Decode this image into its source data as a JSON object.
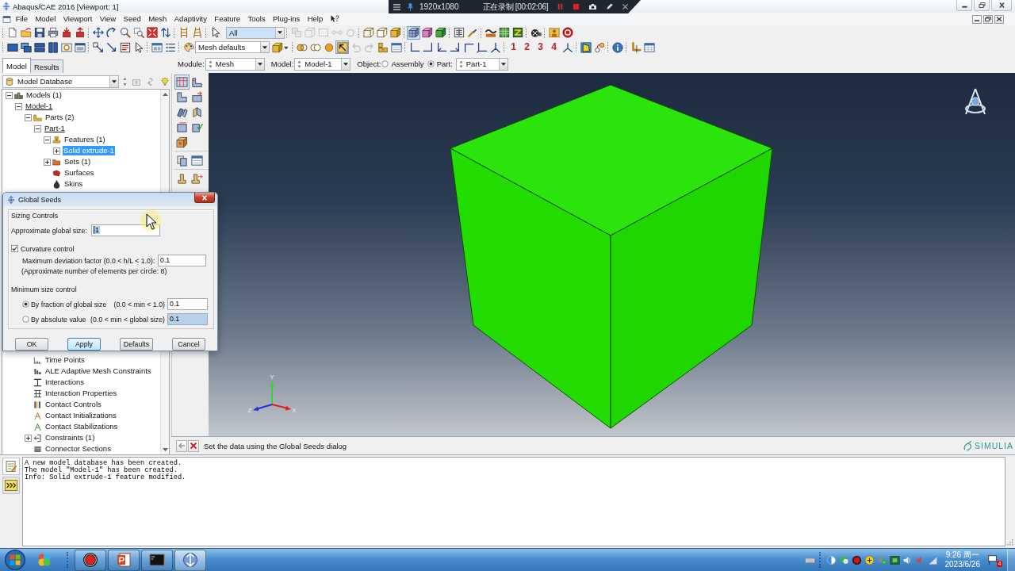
{
  "window": {
    "title": "Abaqus/CAE 2016 [Viewport: 1]"
  },
  "recorder": {
    "resolution": "1920x1080",
    "status": "正在录制 [00:02:06]"
  },
  "menu": [
    "File",
    "Model",
    "Viewport",
    "View",
    "Seed",
    "Mesh",
    "Adaptivity",
    "Feature",
    "Tools",
    "Plug-ins",
    "Help"
  ],
  "toolbars": [
    [
      [
        {
          "kind": "button",
          "pressed": false,
          "disabled": false
        },
        {
          "kind": "button",
          "pressed": false,
          "disabled": false
        },
        {
          "kind": "button",
          "pressed": false,
          "disabled": false
        },
        {
          "kind": "button",
          "pressed": false,
          "disabled": false
        },
        {
          "kind": "button",
          "pressed": false,
          "disabled": false
        },
        {
          "kind": "button",
          "pressed": false,
          "disabled": false
        }
      ],
      [
        {
          "kind": "button",
          "pressed": false,
          "disabled": false
        },
        {
          "kind": "button",
          "pressed": false,
          "disabled": false
        },
        {
          "kind": "button",
          "pressed": false,
          "disabled": false
        },
        {
          "kind": "button",
          "pressed": false,
          "disabled": false
        },
        {
          "kind": "button",
          "pressed": false,
          "disabled": false
        },
        {
          "kind": "button",
          "pressed": false,
          "disabled": false
        }
      ],
      [
        {
          "kind": "button",
          "pressed": false,
          "disabled": false
        },
        {
          "kind": "button",
          "pressed": false,
          "disabled": false
        }
      ],
      [
        {
          "kind": "button",
          "pressed": false,
          "disabled": false
        },
        {
          "kind": "combo",
          "value": "All"
        }
      ],
      [
        {
          "kind": "button",
          "pressed": false,
          "disabled": true
        },
        {
          "kind": "button",
          "pressed": false,
          "disabled": true
        },
        {
          "kind": "button",
          "pressed": false,
          "disabled": true
        },
        {
          "kind": "button",
          "pressed": false,
          "disabled": true
        },
        {
          "kind": "button",
          "pressed": false,
          "disabled": true
        }
      ],
      [
        {
          "kind": "button",
          "pressed": false,
          "disabled": false
        },
        {
          "kind": "button",
          "pressed": false,
          "disabled": false
        },
        {
          "kind": "button",
          "pressed": false,
          "disabled": false
        }
      ],
      [
        {
          "kind": "button",
          "pressed": true,
          "disabled": false
        },
        {
          "kind": "button",
          "pressed": false,
          "disabled": false
        },
        {
          "kind": "button",
          "pressed": false,
          "disabled": false
        }
      ],
      [
        {
          "kind": "button",
          "pressed": false,
          "disabled": false
        },
        {
          "kind": "button",
          "pressed": false,
          "disabled": false
        }
      ],
      [
        {
          "kind": "button",
          "pressed": false,
          "disabled": false
        },
        {
          "kind": "button",
          "pressed": false,
          "disabled": false
        },
        {
          "kind": "button",
          "pressed": false,
          "disabled": false
        }
      ],
      [
        {
          "kind": "button",
          "pressed": false,
          "disabled": false
        }
      ],
      [
        {
          "kind": "button",
          "pressed": false,
          "disabled": false
        },
        {
          "kind": "button",
          "pressed": false,
          "disabled": false
        }
      ]
    ],
    [
      [
        {
          "kind": "button",
          "pressed": false,
          "disabled": false
        },
        {
          "kind": "button",
          "pressed": false,
          "disabled": false
        },
        {
          "kind": "button",
          "pressed": false,
          "disabled": false
        },
        {
          "kind": "button",
          "pressed": false,
          "disabled": false
        },
        {
          "kind": "button",
          "pressed": false,
          "disabled": false
        },
        {
          "kind": "button",
          "pressed": false,
          "disabled": false
        }
      ],
      [
        {
          "kind": "button",
          "pressed": false,
          "disabled": false
        },
        {
          "kind": "button",
          "pressed": false,
          "disabled": false
        },
        {
          "kind": "button",
          "pressed": false,
          "disabled": false
        },
        {
          "kind": "button",
          "pressed": false,
          "disabled": false
        }
      ],
      [
        {
          "kind": "button",
          "pressed": false,
          "disabled": false
        },
        {
          "kind": "button",
          "pressed": false,
          "disabled": false
        }
      ],
      [
        {
          "kind": "button",
          "pressed": false,
          "disabled": false
        },
        {
          "kind": "combo",
          "value": "Mesh defaults"
        },
        {
          "kind": "button",
          "pressed": false,
          "disabled": false
        }
      ],
      [
        {
          "kind": "button",
          "pressed": false,
          "disabled": false
        },
        {
          "kind": "button",
          "pressed": false,
          "disabled": false
        },
        {
          "kind": "button",
          "pressed": false,
          "disabled": false
        },
        {
          "kind": "button",
          "pressed": true,
          "disabled": false
        },
        {
          "kind": "button",
          "pressed": false,
          "disabled": true
        },
        {
          "kind": "button",
          "pressed": false,
          "disabled": true
        },
        {
          "kind": "button",
          "pressed": false,
          "disabled": false
        },
        {
          "kind": "button",
          "pressed": false,
          "disabled": false
        }
      ],
      [
        {
          "kind": "button",
          "pressed": false,
          "disabled": false
        },
        {
          "kind": "button",
          "pressed": false,
          "disabled": false
        },
        {
          "kind": "button",
          "pressed": false,
          "disabled": false
        },
        {
          "kind": "button",
          "pressed": false,
          "disabled": false
        },
        {
          "kind": "button",
          "pressed": false,
          "disabled": false
        },
        {
          "kind": "button",
          "pressed": false,
          "disabled": false
        },
        {
          "kind": "button",
          "pressed": false,
          "disabled": false
        }
      ],
      [
        {
          "kind": "digit",
          "label": "1"
        },
        {
          "kind": "digit",
          "label": "2"
        },
        {
          "kind": "digit",
          "label": "3"
        },
        {
          "kind": "digit",
          "label": "4"
        },
        {
          "kind": "button",
          "pressed": false,
          "disabled": false
        }
      ],
      [
        {
          "kind": "button",
          "pressed": false,
          "disabled": false
        },
        {
          "kind": "button",
          "pressed": false,
          "disabled": false
        }
      ],
      [
        {
          "kind": "button",
          "pressed": false,
          "disabled": false
        }
      ],
      [
        {
          "kind": "button",
          "pressed": false,
          "disabled": false
        },
        {
          "kind": "button",
          "pressed": false,
          "disabled": false
        }
      ]
    ]
  ],
  "context": {
    "module": {
      "label": "Module:",
      "value": "Mesh"
    },
    "model": {
      "label": "Model:",
      "value": "Model-1"
    },
    "object": {
      "label": "Object:",
      "options": [
        {
          "label": "Assembly",
          "selected": false
        },
        {
          "label": "Part:",
          "selected": true
        }
      ]
    },
    "part": {
      "value": "Part-1"
    }
  },
  "model_tree": {
    "tabs": [
      {
        "label": "Model",
        "selected": true
      },
      {
        "label": "Results",
        "selected": false
      }
    ],
    "source": "Model Database",
    "items": [
      {
        "label": "Models (1)",
        "kind": "models",
        "expanded": true,
        "selected": false,
        "current": false,
        "children": [
          {
            "label": "Model-1",
            "expanded": true,
            "selected": false,
            "current": true,
            "children": [
              {
                "label": "Parts (2)",
                "kind": "parts",
                "expanded": true,
                "selected": false,
                "current": false,
                "children": [
                  {
                    "label": "Part-1",
                    "expanded": true,
                    "selected": false,
                    "current": true,
                    "children": [
                      {
                        "label": "Features (1)",
                        "kind": "features",
                        "expanded": true,
                        "selected": false,
                        "current": false,
                        "children": [
                          {
                            "label": "Solid extrude-1",
                            "expanded": false,
                            "selected": true,
                            "current": false
                          }
                        ]
                      },
                      {
                        "label": "Sets (1)",
                        "kind": "sets",
                        "expanded": false,
                        "selected": false,
                        "current": false
                      },
                      {
                        "label": "Surfaces",
                        "kind": "surfaces",
                        "selected": false,
                        "current": false
                      },
                      {
                        "label": "Skins",
                        "kind": "skins",
                        "selected": false,
                        "current": false
                      }
                    ]
                  }
                ]
              },
              {
                "label": "Time Points",
                "kind": "timepoints",
                "selected": false,
                "current": false
              },
              {
                "label": "ALE Adaptive Mesh Constraints",
                "kind": "adaptive",
                "selected": false,
                "current": false
              },
              {
                "label": "Interactions",
                "kind": "interactions",
                "selected": false,
                "current": false
              },
              {
                "label": "Interaction Properties",
                "kind": "properties",
                "selected": false,
                "current": false
              },
              {
                "label": "Contact Controls",
                "kind": "controls",
                "selected": false,
                "current": false
              },
              {
                "label": "Contact Initializations",
                "kind": "initializations",
                "selected": false,
                "current": false
              },
              {
                "label": "Contact Stabilizations",
                "kind": "stabilizations",
                "selected": false,
                "current": false
              },
              {
                "label": "Constraints (1)",
                "kind": "constraints",
                "expanded": false,
                "selected": false,
                "current": false
              },
              {
                "label": "Connector Sections",
                "kind": "connectors",
                "selected": false,
                "current": false
              }
            ]
          }
        ]
      }
    ]
  },
  "toolbox": [
    [
      {
        "pressed": true
      },
      {
        "pressed": false
      },
      {
        "pressed": false
      },
      {
        "pressed": false
      },
      {
        "pressed": false
      },
      {
        "pressed": false
      },
      {
        "pressed": false
      },
      {
        "pressed": false
      },
      {
        "pressed": false
      }
    ],
    [
      {
        "pressed": false
      },
      {
        "pressed": false
      }
    ],
    [
      {
        "pressed": false
      },
      {
        "pressed": false
      }
    ]
  ],
  "viewport": {
    "axes": {
      "x": "X",
      "y": "Y",
      "z": "Z"
    }
  },
  "dialog": {
    "title": "Global Seeds",
    "group": "Sizing Controls",
    "size": {
      "label": "Approximate global size:",
      "value": "1",
      "text_selected": true
    },
    "curvature": {
      "label": "Curvature control",
      "checked": true
    },
    "deviation": {
      "label": "Maximum deviation factor (0.0 < h/L < 1.0):",
      "value": "0.1"
    },
    "note": "(Approximate number of elements per circle: 8)",
    "min_size": {
      "label": "Minimum size control",
      "options": [
        {
          "label": "By fraction of global size",
          "range": "(0.0 < min < 1.0)",
          "value": "0.1",
          "selected": true,
          "disabled": false
        },
        {
          "label": "By absolute value",
          "range": "(0.0 < min < global size)",
          "value": "0.1",
          "selected": false,
          "disabled": true
        }
      ]
    },
    "buttons": [
      {
        "label": "OK",
        "focused": false
      },
      {
        "label": "Apply",
        "focused": true
      },
      {
        "label": "Defaults",
        "focused": false
      },
      {
        "label": "Cancel",
        "focused": false
      }
    ]
  },
  "prompt": {
    "text": "Set the data using the Global Seeds dialog",
    "brand": "SIMULIA"
  },
  "messages": {
    "tabs": [
      {
        "selected": true
      },
      {
        "selected": false
      }
    ],
    "lines": [
      "A new model database has been created.",
      "The model \"Model-1\" has been created.",
      "Info: Solid extrude-1 feature modified."
    ]
  },
  "taskbar": {
    "apps": [
      {
        "running": false,
        "selected": false
      },
      {
        "running": true,
        "selected": false
      },
      {
        "running": true,
        "selected": false
      },
      {
        "running": true,
        "selected": false
      },
      {
        "running": true,
        "selected": true
      }
    ],
    "clock": {
      "time": "9:26 周一",
      "date": "2023/6/26"
    },
    "notifications": "4"
  }
}
